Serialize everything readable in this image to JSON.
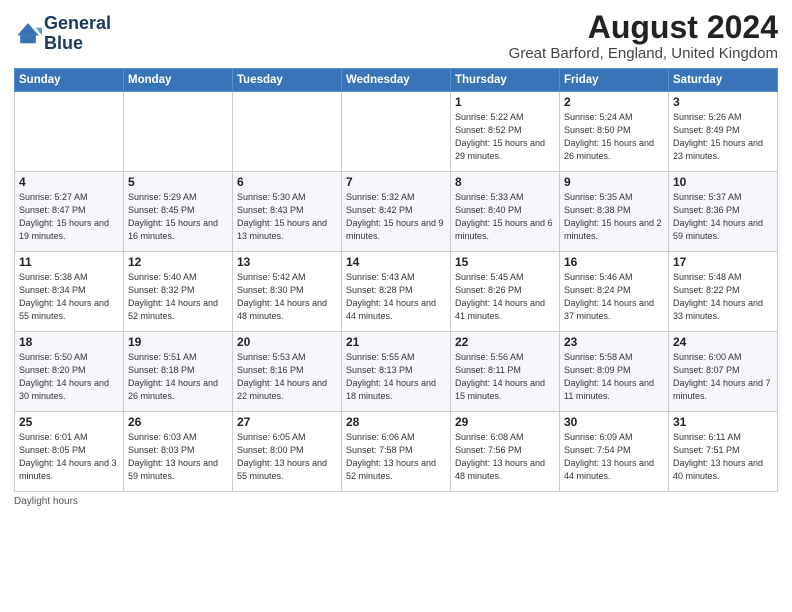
{
  "logo": {
    "line1": "General",
    "line2": "Blue"
  },
  "title": "August 2024",
  "subtitle": "Great Barford, England, United Kingdom",
  "days_header": [
    "Sunday",
    "Monday",
    "Tuesday",
    "Wednesday",
    "Thursday",
    "Friday",
    "Saturday"
  ],
  "weeks": [
    [
      {
        "day": "",
        "info": ""
      },
      {
        "day": "",
        "info": ""
      },
      {
        "day": "",
        "info": ""
      },
      {
        "day": "",
        "info": ""
      },
      {
        "day": "1",
        "info": "Sunrise: 5:22 AM\nSunset: 8:52 PM\nDaylight: 15 hours\nand 29 minutes."
      },
      {
        "day": "2",
        "info": "Sunrise: 5:24 AM\nSunset: 8:50 PM\nDaylight: 15 hours\nand 26 minutes."
      },
      {
        "day": "3",
        "info": "Sunrise: 5:26 AM\nSunset: 8:49 PM\nDaylight: 15 hours\nand 23 minutes."
      }
    ],
    [
      {
        "day": "4",
        "info": "Sunrise: 5:27 AM\nSunset: 8:47 PM\nDaylight: 15 hours\nand 19 minutes."
      },
      {
        "day": "5",
        "info": "Sunrise: 5:29 AM\nSunset: 8:45 PM\nDaylight: 15 hours\nand 16 minutes."
      },
      {
        "day": "6",
        "info": "Sunrise: 5:30 AM\nSunset: 8:43 PM\nDaylight: 15 hours\nand 13 minutes."
      },
      {
        "day": "7",
        "info": "Sunrise: 5:32 AM\nSunset: 8:42 PM\nDaylight: 15 hours\nand 9 minutes."
      },
      {
        "day": "8",
        "info": "Sunrise: 5:33 AM\nSunset: 8:40 PM\nDaylight: 15 hours\nand 6 minutes."
      },
      {
        "day": "9",
        "info": "Sunrise: 5:35 AM\nSunset: 8:38 PM\nDaylight: 15 hours\nand 2 minutes."
      },
      {
        "day": "10",
        "info": "Sunrise: 5:37 AM\nSunset: 8:36 PM\nDaylight: 14 hours\nand 59 minutes."
      }
    ],
    [
      {
        "day": "11",
        "info": "Sunrise: 5:38 AM\nSunset: 8:34 PM\nDaylight: 14 hours\nand 55 minutes."
      },
      {
        "day": "12",
        "info": "Sunrise: 5:40 AM\nSunset: 8:32 PM\nDaylight: 14 hours\nand 52 minutes."
      },
      {
        "day": "13",
        "info": "Sunrise: 5:42 AM\nSunset: 8:30 PM\nDaylight: 14 hours\nand 48 minutes."
      },
      {
        "day": "14",
        "info": "Sunrise: 5:43 AM\nSunset: 8:28 PM\nDaylight: 14 hours\nand 44 minutes."
      },
      {
        "day": "15",
        "info": "Sunrise: 5:45 AM\nSunset: 8:26 PM\nDaylight: 14 hours\nand 41 minutes."
      },
      {
        "day": "16",
        "info": "Sunrise: 5:46 AM\nSunset: 8:24 PM\nDaylight: 14 hours\nand 37 minutes."
      },
      {
        "day": "17",
        "info": "Sunrise: 5:48 AM\nSunset: 8:22 PM\nDaylight: 14 hours\nand 33 minutes."
      }
    ],
    [
      {
        "day": "18",
        "info": "Sunrise: 5:50 AM\nSunset: 8:20 PM\nDaylight: 14 hours\nand 30 minutes."
      },
      {
        "day": "19",
        "info": "Sunrise: 5:51 AM\nSunset: 8:18 PM\nDaylight: 14 hours\nand 26 minutes."
      },
      {
        "day": "20",
        "info": "Sunrise: 5:53 AM\nSunset: 8:16 PM\nDaylight: 14 hours\nand 22 minutes."
      },
      {
        "day": "21",
        "info": "Sunrise: 5:55 AM\nSunset: 8:13 PM\nDaylight: 14 hours\nand 18 minutes."
      },
      {
        "day": "22",
        "info": "Sunrise: 5:56 AM\nSunset: 8:11 PM\nDaylight: 14 hours\nand 15 minutes."
      },
      {
        "day": "23",
        "info": "Sunrise: 5:58 AM\nSunset: 8:09 PM\nDaylight: 14 hours\nand 11 minutes."
      },
      {
        "day": "24",
        "info": "Sunrise: 6:00 AM\nSunset: 8:07 PM\nDaylight: 14 hours\nand 7 minutes."
      }
    ],
    [
      {
        "day": "25",
        "info": "Sunrise: 6:01 AM\nSunset: 8:05 PM\nDaylight: 14 hours\nand 3 minutes."
      },
      {
        "day": "26",
        "info": "Sunrise: 6:03 AM\nSunset: 8:03 PM\nDaylight: 13 hours\nand 59 minutes."
      },
      {
        "day": "27",
        "info": "Sunrise: 6:05 AM\nSunset: 8:00 PM\nDaylight: 13 hours\nand 55 minutes."
      },
      {
        "day": "28",
        "info": "Sunrise: 6:06 AM\nSunset: 7:58 PM\nDaylight: 13 hours\nand 52 minutes."
      },
      {
        "day": "29",
        "info": "Sunrise: 6:08 AM\nSunset: 7:56 PM\nDaylight: 13 hours\nand 48 minutes."
      },
      {
        "day": "30",
        "info": "Sunrise: 6:09 AM\nSunset: 7:54 PM\nDaylight: 13 hours\nand 44 minutes."
      },
      {
        "day": "31",
        "info": "Sunrise: 6:11 AM\nSunset: 7:51 PM\nDaylight: 13 hours\nand 40 minutes."
      }
    ]
  ],
  "footer": "Daylight hours"
}
